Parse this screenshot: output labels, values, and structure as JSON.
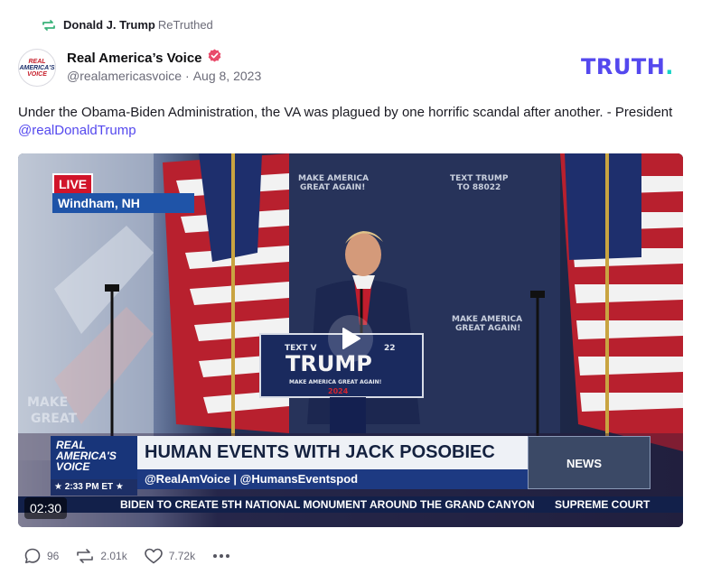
{
  "retruth": {
    "user": "Donald J. Trump",
    "label": "ReTruthed"
  },
  "post": {
    "author_name": "Real America’s Voice",
    "handle": "@realamericasvoice",
    "separator": "·",
    "date": "Aug 8, 2023",
    "text_before_mention": "Under the Obama-Biden Administration, the VA was plagued by one horrific scandal after another. - President ",
    "mention": "@realDonaldTrump"
  },
  "avatar": {
    "line1": "REAL",
    "line2": "AMERICA'S",
    "line3": "VOICE"
  },
  "brand": {
    "name": "TRUTH",
    "dot": ".",
    "color": "#5448ee",
    "dot_color": "#16d4c6"
  },
  "video": {
    "duration": "02:30",
    "live_label": "LIVE",
    "location": "Windham, NH",
    "podium_top": "TEXT V",
    "podium_top_right": "22",
    "podium_name": "TRUMP",
    "podium_slogan": "MAKE AMERICA GREAT AGAIN!",
    "podium_year": "2024",
    "backdrop_slogan_1": "MAKE AMERICA",
    "backdrop_slogan_2": "GREAT AGAIN!",
    "backdrop_text_1": "TEXT TRUMP",
    "backdrop_text_2": "TO 88022",
    "show_logo_1": "REAL",
    "show_logo_2": "AMERICA'S",
    "show_logo_3": "VOICE",
    "time": "★ 2:33 PM ET ★",
    "show_title": "HUMAN EVENTS WITH JACK POSOBIEC",
    "handles": "@RealAmVoice | @HumansEventspod",
    "news_label": "NEWS",
    "ticker_main": "BIDEN TO CREATE 5TH NATIONAL MONUMENT AROUND THE GRAND CANYON",
    "ticker_next": "SUPREME COURT"
  },
  "actions": {
    "replies": "96",
    "retruths": "2.01k",
    "likes": "7.72k"
  },
  "icons": {
    "retruth": "retruth-icon",
    "verified": "verified-badge-icon",
    "play": "play-icon",
    "reply": "reply-icon",
    "retruth_action": "retruth-action-icon",
    "like": "heart-icon",
    "more": "more-icon"
  }
}
